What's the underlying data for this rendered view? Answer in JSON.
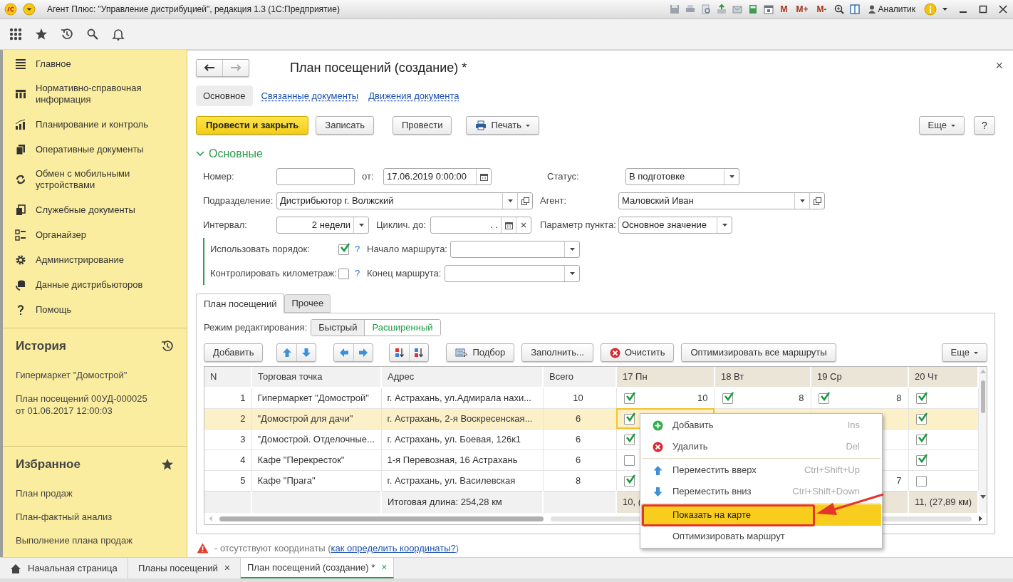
{
  "title_bar": {
    "title": "Агент Плюс: \"Управление дистрибуцией\", редакция 1.3  (1С:Предприятие)",
    "memory_buttons": [
      "M",
      "M+",
      "M-"
    ],
    "user": "Аналитик"
  },
  "sidebar": {
    "sections": [
      {
        "label": "Главное"
      },
      {
        "label": "Нормативно-справочная информация"
      },
      {
        "label": "Планирование и контроль"
      },
      {
        "label": "Оперативные документы"
      },
      {
        "label": "Обмен с мобильными устройствами"
      },
      {
        "label": "Служебные документы"
      },
      {
        "label": "Органайзер"
      },
      {
        "label": "Администрирование"
      },
      {
        "label": "Данные дистрибьюторов"
      },
      {
        "label": "Помощь"
      }
    ],
    "history": {
      "title": "История",
      "items": [
        "Гипермаркет \"Домострой\"",
        "План посещений 00УД-000025 от 01.06.2017 12:00:03"
      ]
    },
    "favorites": {
      "title": "Избранное",
      "items": [
        "План продаж",
        "План-фактный анализ",
        "Выполнение плана продаж"
      ]
    }
  },
  "form": {
    "title": "План посещений  (создание) *",
    "close": "×",
    "nav_tabs": [
      {
        "label": "Основное",
        "selected": true
      },
      {
        "label": "Связанные документы",
        "selected": false
      },
      {
        "label": "Движения документа",
        "selected": false
      }
    ],
    "actions": [
      {
        "label": "Провести и закрыть",
        "kind": "primary"
      },
      {
        "label": "Записать",
        "kind": "plain"
      },
      {
        "label": "Провести",
        "kind": "plain"
      },
      {
        "label": "Печать",
        "kind": "print"
      }
    ],
    "more": "Еще",
    "help": "?",
    "group": {
      "title": "Основные",
      "expanded": true
    },
    "number": {
      "label": "Номер:"
    },
    "date": {
      "label": "от:",
      "value": "17.06.2019  0:00:00"
    },
    "status": {
      "label": "Статус:",
      "value": "В подготовке"
    },
    "division": {
      "label": "Подразделение:",
      "value": "Дистрибьютор г. Волжский"
    },
    "agent": {
      "label": "Агент:",
      "value": "Маловский Иван"
    },
    "interval": {
      "label": "Интервал:",
      "value": "2 недели"
    },
    "cycle_until": {
      "label": "Циклич. до:",
      "value": ".  ."
    },
    "point_param": {
      "label": "Параметр пункта:",
      "value": "Основное значение"
    },
    "use_order": {
      "label": "Использовать порядок:",
      "checked": true,
      "help": "?"
    },
    "control_km": {
      "label": "Контролировать километраж:",
      "checked": false,
      "help": "?"
    },
    "route_start": {
      "label": "Начало маршрута:"
    },
    "route_end": {
      "label": "Конец маршрута:"
    }
  },
  "tabs": [
    {
      "label": "План посещений",
      "selected": true
    },
    {
      "label": "Прочее",
      "selected": false
    }
  ],
  "edit_mode": {
    "label": "Режим редактирования:",
    "options": [
      {
        "label": "Быстрый",
        "selected": false
      },
      {
        "label": "Расширенный",
        "selected": true
      }
    ]
  },
  "table_toolbar": {
    "add": "Добавить",
    "pick": "Подбор",
    "fill": "Заполнить...",
    "clear": "Очистить",
    "optimize_all": "Оптимизировать все маршруты",
    "more": "Еще"
  },
  "table": {
    "columns": [
      "N",
      "Торговая точка",
      "Адрес",
      "Всего",
      "17 Пн",
      "18 Вт",
      "19 Ср",
      "20 Чт"
    ],
    "rows": [
      {
        "n": "1",
        "outlet": "Гипермаркет \"Домострой\"",
        "address": "г. Астрахань, ул.Адмирала нахи...",
        "total": "10",
        "selected": false,
        "days": {
          "d17": {
            "checked": true,
            "value": "10",
            "current": false
          },
          "d18": {
            "checked": true,
            "value": "8",
            "current": false
          },
          "d19": {
            "checked": true,
            "value": "8",
            "current": false
          },
          "d20": {
            "checked": true,
            "current": false
          }
        }
      },
      {
        "n": "2",
        "outlet": "\"Домострой для дачи\"",
        "address": "г. Астрахань, 2-я Воскресенская...",
        "total": "6",
        "selected": true,
        "days": {
          "d17": {
            "checked": true,
            "current": true
          },
          "d20": {
            "checked": true,
            "current": false
          }
        }
      },
      {
        "n": "3",
        "outlet": "\"Домострой. Отделочные...",
        "address": "г. Астрахань, ул. Боевая, 126к1",
        "total": "6",
        "selected": false,
        "days": {
          "d17": {
            "checked": true,
            "current": false
          },
          "d20": {
            "checked": true,
            "current": false
          }
        }
      },
      {
        "n": "4",
        "outlet": "Кафе \"Перекресток\"",
        "address": "1-я Перевозная, 16 Астрахань",
        "total": "6",
        "selected": false,
        "days": {
          "d17": {
            "checked": false,
            "current": false
          },
          "d20": {
            "checked": true,
            "current": false
          }
        }
      },
      {
        "n": "5",
        "outlet": "Кафе \"Прага\"",
        "address": "г. Астрахань, ул. Василевская",
        "total": "8",
        "selected": false,
        "days": {
          "d17": {
            "checked": true,
            "current": false
          },
          "d19": {
            "value": "7",
            "current": false
          },
          "d20": {
            "checked": false,
            "current": false
          }
        }
      }
    ],
    "footer": {
      "address": "Итоговая длина: 254,28 км",
      "days": {
        "d17": "10, (",
        "d20": "11, (27,89 км)"
      }
    }
  },
  "context_menu": [
    {
      "kind": "add",
      "label": "Добавить",
      "shortcut": "Ins",
      "selected": false
    },
    {
      "kind": "delete",
      "label": "Удалить",
      "shortcut": "Del",
      "selected": false
    },
    {
      "kind": "separator"
    },
    {
      "kind": "up",
      "label": "Переместить вверх",
      "shortcut": "Ctrl+Shift+Up",
      "selected": false
    },
    {
      "kind": "down",
      "label": "Переместить вниз",
      "shortcut": "Ctrl+Shift+Down",
      "selected": false
    },
    {
      "kind": "separator"
    },
    {
      "kind": "plain",
      "label": "Показать на карте",
      "selected": true,
      "annotated": true
    },
    {
      "kind": "plain",
      "label": "Оптимизировать маршрут",
      "selected": false,
      "annotated": false
    }
  ],
  "warning": {
    "text": "- отсутствуют координаты (",
    "link": "как определить координаты?",
    "suffix": ")"
  },
  "bottom_tabs": [
    {
      "kind": "home",
      "label": "Начальная страница",
      "selected": false
    },
    {
      "kind": "closable",
      "label": "Планы посещений",
      "close": "×",
      "selected": false
    },
    {
      "kind": "closable",
      "label": "План посещений  (создание) *",
      "close": "×",
      "selected": true
    }
  ]
}
